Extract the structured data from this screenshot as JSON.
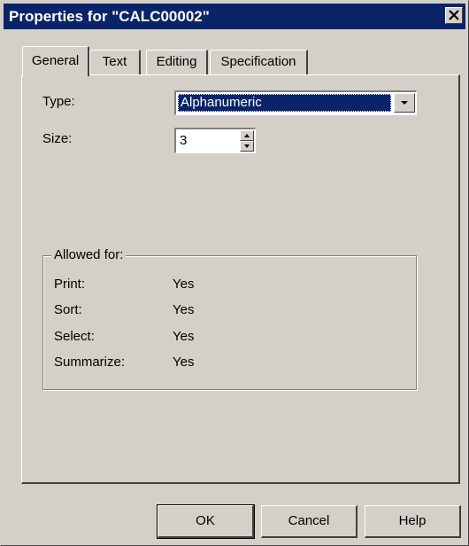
{
  "window": {
    "title": "Properties for \"CALC00002\"",
    "close_symbol": "✕"
  },
  "tabs": [
    {
      "label": "General",
      "active": true
    },
    {
      "label": "Text",
      "active": false
    },
    {
      "label": "Editing",
      "active": false
    },
    {
      "label": "Specification",
      "active": false
    }
  ],
  "general": {
    "type_label": "Type:",
    "type_value": "Alphanumeric",
    "size_label": "Size:",
    "size_value": "3"
  },
  "allowed": {
    "legend": "Allowed for:",
    "rows": [
      {
        "label": "Print:",
        "value": "Yes"
      },
      {
        "label": "Sort:",
        "value": "Yes"
      },
      {
        "label": "Select:",
        "value": "Yes"
      },
      {
        "label": "Summarize:",
        "value": "Yes"
      }
    ]
  },
  "buttons": {
    "ok": "OK",
    "cancel": "Cancel",
    "help": "Help"
  },
  "colors": {
    "titlebar": "#0a246a",
    "face": "#d4d0c8",
    "selection": "#0a246a"
  }
}
